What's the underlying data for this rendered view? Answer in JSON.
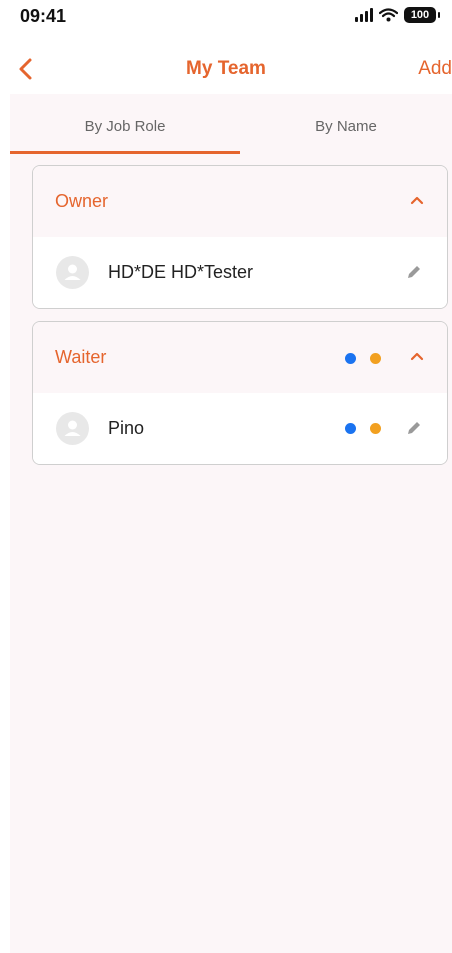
{
  "status": {
    "time": "09:41",
    "battery": "100"
  },
  "nav": {
    "title": "My Team",
    "add_label": "Add"
  },
  "tabs": [
    {
      "label": "By Job Role"
    },
    {
      "label": "By Name"
    }
  ],
  "colors": {
    "accent": "#e5652e",
    "dot_blue": "#1a73f0",
    "dot_orange": "#f2a020"
  },
  "groups": [
    {
      "title": "Owner",
      "members": [
        {
          "name": "HD*DE HD*Tester"
        }
      ]
    },
    {
      "title": "Waiter",
      "members": [
        {
          "name": "Pino"
        }
      ]
    }
  ],
  "icons": [
    "back-chevron-icon",
    "signal-icon",
    "wifi-icon",
    "battery-icon",
    "chevron-up-icon",
    "user-avatar-icon",
    "pencil-edit-icon"
  ]
}
